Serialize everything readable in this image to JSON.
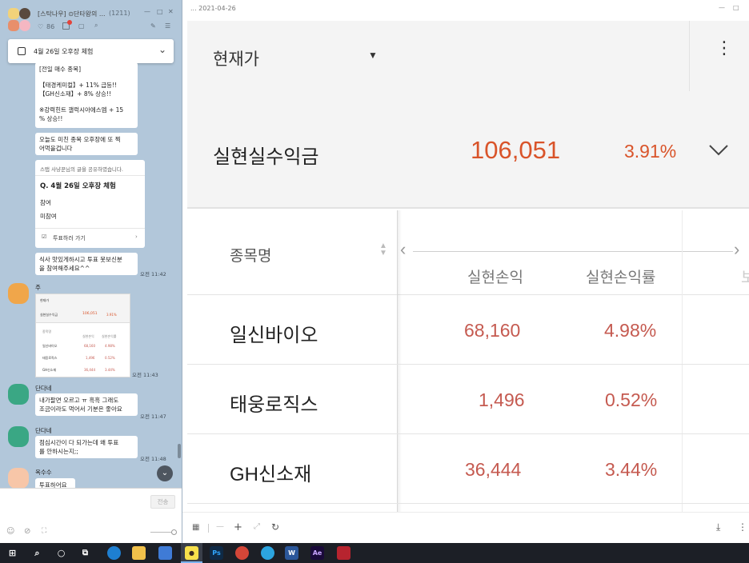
{
  "chat": {
    "title": "[스탁나우] ⊙단타왕의 ...",
    "member_count": "(1211)",
    "likes": "86",
    "notice": "4월 26일 오후장 체험",
    "messages": {
      "m1_l1": "[전일 매수 종목]",
      "m1_l2": "【태경케미컬】+ 11% 급등!!",
      "m1_l3": "【GH신소재】+ 8% 상승!!",
      "m1_l4": "※강력힌트 갤럭시아에스엠 + 15",
      "m1_l5": "% 상승!!",
      "m2_l1": "오늘도 미친 종목 오후장에 또 찍",
      "m2_l2": "어먹을겁니다",
      "poll_shared": "스탭 사냥꾼님의 글을 공유하였습니다.",
      "poll_question": "Q. 4월 26일 오후장 체험",
      "poll_opt1": "참여",
      "poll_opt2": "미참여",
      "poll_vote": "투표하러 가기",
      "m3_l1": "식사 맛있게하시고 투표 못보신분",
      "m3_l2": "을 참여해주세요^^",
      "m3_time": "오전 11:42",
      "sender1": "주",
      "img_time": "오전 11:43",
      "sender2": "단다네",
      "m4_l1": "내가팔면 오르고 ㅠ 흑흑 그래도",
      "m4_l2": "조금이라도 먹어서 기분은 좋아요",
      "m4_time": "오전 11:47",
      "sender3": "단다네",
      "m5_l1": "점심시간이 다 되가는데 왜 투표",
      "m5_l2": "를 안하시는지;;",
      "m5_time": "오전 11:48",
      "sender4": "옥수수",
      "m6_l1": "투표하어요"
    },
    "send_label": "전송",
    "thumb": {
      "title": "현재가",
      "row_label": "실현실수익금",
      "row_value": "106,051",
      "row_pct": "3.91%",
      "col_name": "종목명",
      "col_pnl": "실현손익",
      "col_rate": "실현손익률",
      "r1": [
        "일신바이오",
        "68,160",
        "4.98%"
      ],
      "r2": [
        "태웅로직스",
        "1,496",
        "0.52%"
      ],
      "r3": [
        "GH신소재",
        "36,444",
        "3.44%"
      ]
    }
  },
  "app": {
    "window_title": "... 2021-04-26",
    "section_title": "현재가",
    "summary_label": "실현실수익금",
    "summary_value": "106,051",
    "summary_pct": "3.91%",
    "columns": {
      "name": "종목명",
      "pnl": "실현손익",
      "rate": "실현손익률",
      "next_partial": "보"
    },
    "rows": [
      {
        "name": "일신바이오",
        "pnl": "68,160",
        "rate": "4.98%"
      },
      {
        "name": "태웅로직스",
        "pnl": "1,496",
        "rate": "0.52%"
      },
      {
        "name": "GH신소재",
        "pnl": "36,444",
        "rate": "3.44%"
      }
    ],
    "colors": {
      "profit": "#c55a50",
      "summary_value": "#d9542a"
    }
  },
  "taskbar": {
    "apps": [
      "start-icon",
      "search-icon",
      "cortana-icon",
      "task-view-icon",
      "edge-icon",
      "file-explorer-icon",
      "store-icon",
      "kakaotalk-icon",
      "photoshop-icon",
      "chrome-icon",
      "telegram-icon",
      "word-icon",
      "after-effects-icon",
      "app-icon"
    ],
    "ps_label": "Ps",
    "word_label": "W",
    "ae_label": "Ae"
  }
}
